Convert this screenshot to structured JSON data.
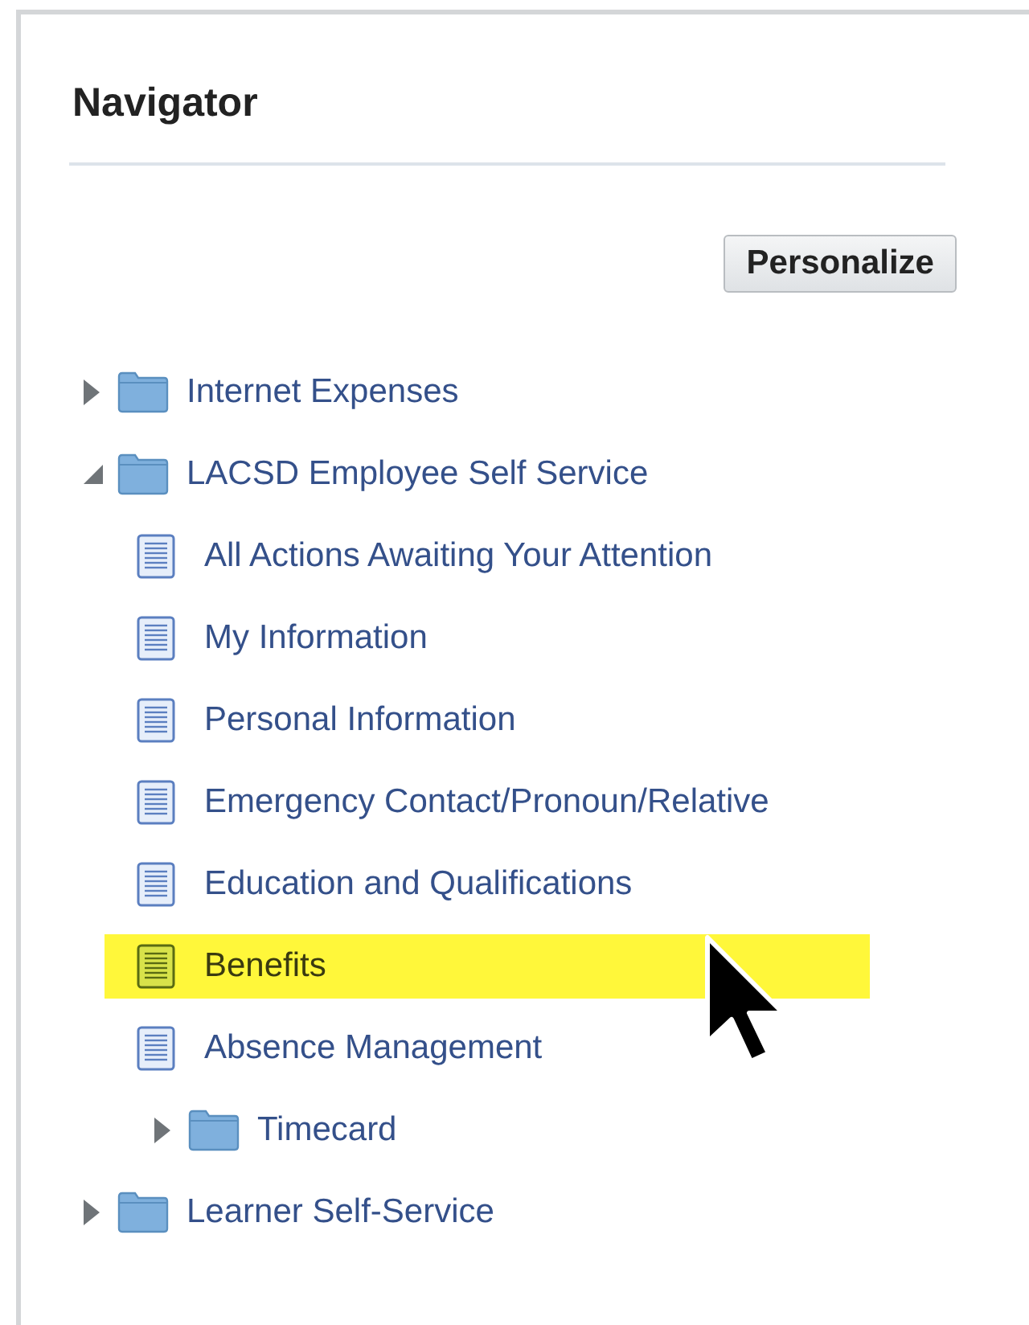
{
  "panel": {
    "title": "Navigator"
  },
  "personalize_button": "Personalize",
  "tree": [
    {
      "kind": "folder",
      "label": "Internet Expenses",
      "expanded": false
    },
    {
      "kind": "folder",
      "label": "LACSD Employee Self Service",
      "expanded": true,
      "children": [
        {
          "kind": "page",
          "label": "All Actions Awaiting Your Attention",
          "selected": false
        },
        {
          "kind": "page",
          "label": "My Information",
          "selected": false
        },
        {
          "kind": "page",
          "label": "Personal Information",
          "selected": false
        },
        {
          "kind": "page",
          "label": "Emergency Contact/Pronoun/Relative",
          "selected": false
        },
        {
          "kind": "page",
          "label": "Education and Qualifications",
          "selected": false
        },
        {
          "kind": "page",
          "label": "Benefits",
          "selected": true
        },
        {
          "kind": "page",
          "label": "Absence Management",
          "selected": false
        },
        {
          "kind": "folder",
          "label": "Timecard",
          "expanded": false
        }
      ]
    },
    {
      "kind": "folder",
      "label": "Learner Self-Service",
      "expanded": false
    }
  ]
}
